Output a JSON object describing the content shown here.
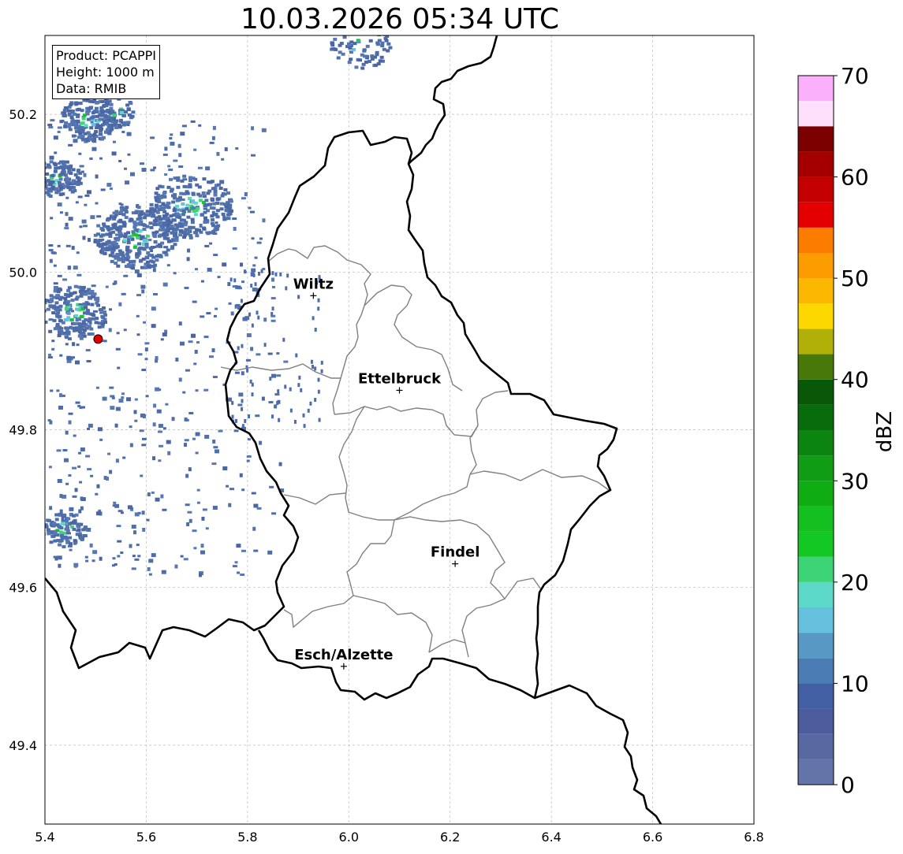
{
  "title": "10.03.2026 05:34 UTC",
  "info": {
    "product": "Product: PCAPPI",
    "height": "Height: 1000 m",
    "source": "Data: RMIB"
  },
  "map": {
    "lon_range": [
      5.4,
      6.8
    ],
    "lat_range": [
      49.3,
      50.3
    ],
    "x_ticks": [
      "5.4",
      "5.6",
      "5.8",
      "6.0",
      "6.2",
      "6.4",
      "6.6",
      "6.8"
    ],
    "y_ticks": [
      "49.4",
      "49.6",
      "49.8",
      "50.0",
      "50.2"
    ],
    "grid": true,
    "radar_site": {
      "lon": 5.505,
      "lat": 49.915,
      "color": "#e00000"
    },
    "cities": [
      {
        "name": "Wiltz",
        "lon": 5.93,
        "lat": 49.97
      },
      {
        "name": "Ettelbruck",
        "lon": 6.1,
        "lat": 49.85
      },
      {
        "name": "Findel",
        "lon": 6.21,
        "lat": 49.63
      },
      {
        "name": "Esch/Alzette",
        "lon": 5.99,
        "lat": 49.5
      }
    ]
  },
  "colorbar": {
    "label": "dBZ",
    "ticks": [
      "0",
      "10",
      "20",
      "30",
      "40",
      "50",
      "60",
      "70"
    ],
    "range": [
      0,
      70
    ],
    "step": 2.5,
    "colors": [
      "#6474a8",
      "#5868a0",
      "#4c5c9c",
      "#4460a4",
      "#4c7cb4",
      "#5898c4",
      "#64c0dc",
      "#5cd8c8",
      "#3cd474",
      "#14c824",
      "#14c020",
      "#10ac14",
      "#109c14",
      "#0c8410",
      "#086c0c",
      "#085808",
      "#487808",
      "#b0b008",
      "#fcd800",
      "#fcb800",
      "#fc9c00",
      "#fc7c00",
      "#e40000",
      "#c40000",
      "#a40000",
      "#7c0000",
      "#fce0fc",
      "#fcb0fc",
      "#fc6cfc",
      "#ec34ec"
    ]
  }
}
